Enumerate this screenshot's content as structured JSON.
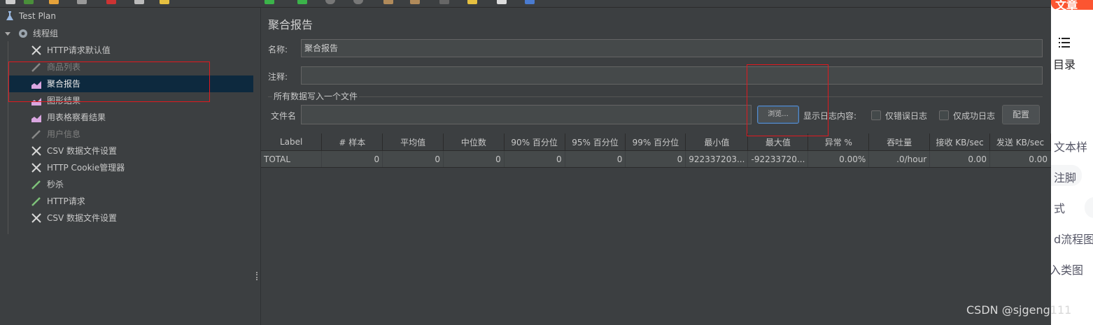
{
  "tree": {
    "items": [
      {
        "label": "Test Plan",
        "icon": "flask-icon"
      },
      {
        "label": "线程组",
        "icon": "gear-icon"
      },
      {
        "label": "HTTP请求默认值",
        "icon": "wrench-icon"
      },
      {
        "label": "商品列表",
        "icon": "pipette-icon"
      },
      {
        "label": "聚合报告",
        "icon": "chart-icon"
      },
      {
        "label": "图形结果",
        "icon": "chart-icon"
      },
      {
        "label": "用表格察看结果",
        "icon": "chart-icon"
      },
      {
        "label": "用户信息",
        "icon": "pipette-icon"
      },
      {
        "label": "CSV 数据文件设置",
        "icon": "wrench-icon"
      },
      {
        "label": "HTTP Cookie管理器",
        "icon": "wrench-icon"
      },
      {
        "label": "秒杀",
        "icon": "pipette-icon"
      },
      {
        "label": "HTTP请求",
        "icon": "pipette-icon"
      },
      {
        "label": "CSV 数据文件设置",
        "icon": "wrench-icon"
      }
    ]
  },
  "panel": {
    "title": "聚合报告",
    "name_label": "名称:",
    "name_value": "聚合报告",
    "comment_label": "注释:",
    "comment_value": "",
    "file_section_title": "所有数据写入一个文件",
    "filename_label": "文件名",
    "filename_value": "",
    "browse_button": "浏览...",
    "log_label": "显示日志内容:",
    "errors_only_label": "仅错误日志",
    "success_only_label": "仅成功日志",
    "config_button": "配置"
  },
  "table": {
    "headers": [
      "Label",
      "# 样本",
      "平均值",
      "中位数",
      "90% 百分位",
      "95% 百分位",
      "99% 百分位",
      "最小值",
      "最大值",
      "异常 %",
      "吞吐量",
      "接收 KB/sec",
      "发送 KB/sec"
    ],
    "rows": [
      [
        "TOTAL",
        "0",
        "0",
        "0",
        "0",
        "0",
        "0",
        "922337203...",
        "-92233720...",
        "0.00%",
        ".0/hour",
        "0.00",
        "0.00"
      ]
    ]
  },
  "blog": {
    "banner": "文章",
    "toc_label": "目录",
    "snippets": [
      "文本样",
      "注脚",
      "式",
      "d流程图",
      "入类图"
    ]
  },
  "watermark": "CSDN @sjgeng111",
  "colors": {
    "background": "#3c3f41",
    "selected": "#0d293e",
    "highlight": "#e0191f"
  }
}
